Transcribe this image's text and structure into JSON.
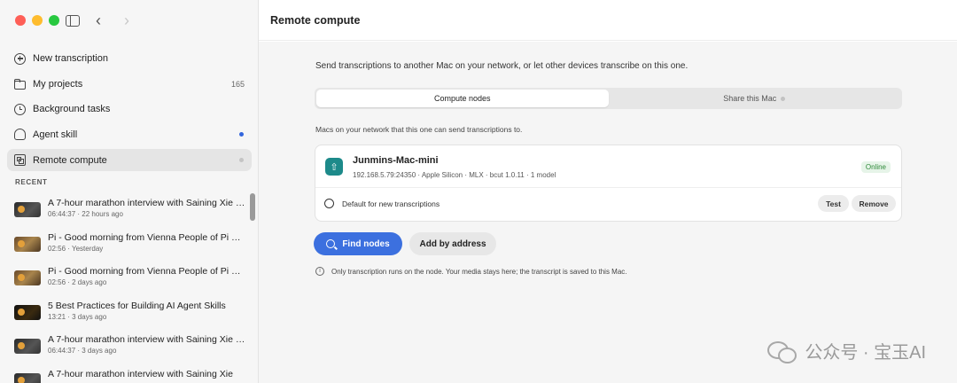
{
  "window": {
    "title": "Remote compute"
  },
  "sidebar": {
    "items": [
      {
        "label": "New transcription",
        "icon": "plus-circle-icon"
      },
      {
        "label": "My projects",
        "icon": "folder-icon",
        "count": "165"
      },
      {
        "label": "Background tasks",
        "icon": "clock-icon"
      },
      {
        "label": "Agent skill",
        "icon": "agent-icon"
      },
      {
        "label": "Remote compute",
        "icon": "remote-compute-icon"
      }
    ],
    "recent_label": "RECENT",
    "recent": [
      {
        "title": "A 7-hour marathon interview with Saining Xie —...",
        "meta": "06:44:37 · 22 hours ago"
      },
      {
        "title": "Pi - Good morning from Vienna People of Pi 😊 ...",
        "meta": "02:56 · Yesterday"
      },
      {
        "title": "Pi - Good morning from Vienna People of Pi 😊 ...",
        "meta": "02:56 · 2 days ago"
      },
      {
        "title": "5 Best Practices for Building AI Agent Skills",
        "meta": "13:21 · 3 days ago"
      },
      {
        "title": "A 7-hour marathon interview with Saining Xie —...",
        "meta": "06:44:37 · 3 days ago"
      },
      {
        "title": "A 7-hour marathon interview with Saining Xie",
        "meta": ""
      }
    ]
  },
  "main": {
    "intro": "Send transcriptions to another Mac on your network, or let other devices transcribe on this one.",
    "tabs": [
      {
        "label": "Compute nodes"
      },
      {
        "label": "Share this Mac"
      }
    ],
    "subtitle": "Macs on your network that this one can send transcriptions to.",
    "node": {
      "name": "Junmins-Mac-mini",
      "detail": "192.168.5.79:24350 · Apple Silicon · MLX · bcut 1.0.11 · 1 model",
      "status": "Online",
      "default_label": "Default for new transcriptions",
      "test_label": "Test",
      "remove_label": "Remove"
    },
    "find_nodes_label": "Find nodes",
    "add_by_address_label": "Add by address",
    "note": "Only transcription runs on the node. Your media stays here; the transcript is saved to this Mac."
  },
  "watermark": "公众号 · 宝玉AI",
  "colors": {
    "accent": "#3c70df",
    "online": "#2f8a3a",
    "node_icon": "#1d8a8a"
  }
}
